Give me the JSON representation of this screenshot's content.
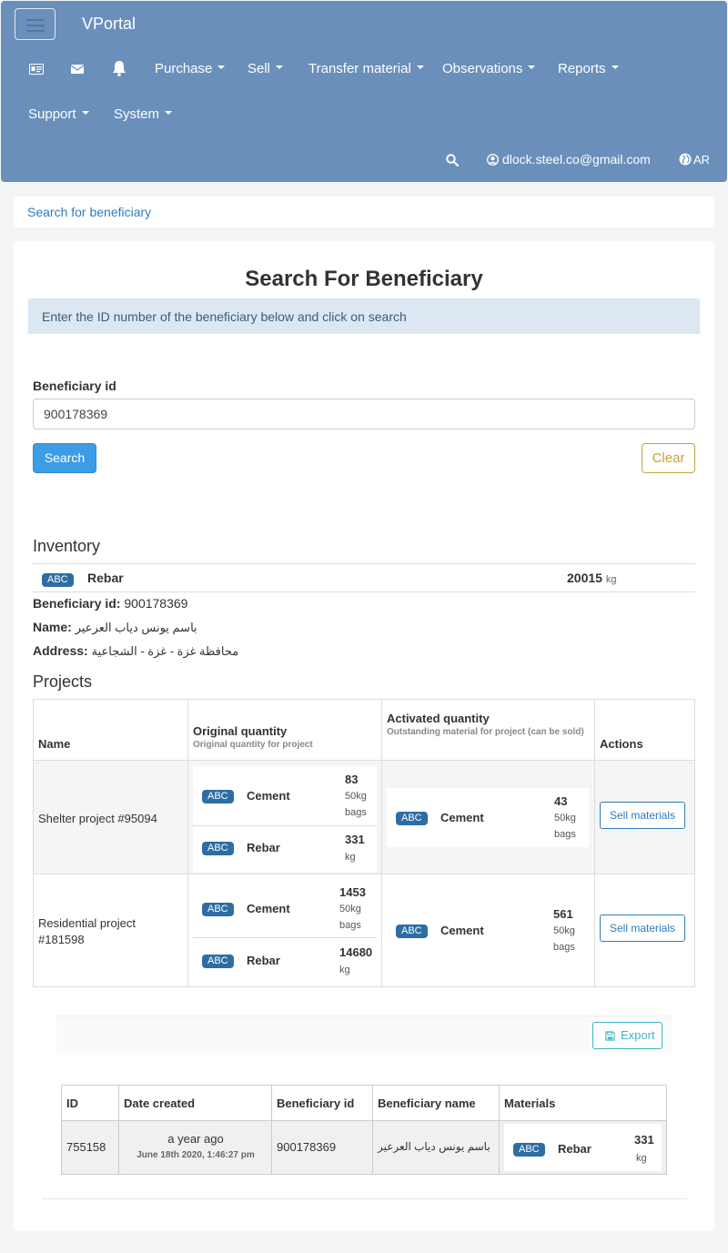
{
  "navbar": {
    "brand": "VPortal",
    "menus": [
      {
        "label": "Purchase"
      },
      {
        "label": "Sell"
      },
      {
        "label": "Transfer material"
      },
      {
        "label": "Observations"
      },
      {
        "label": "Reports"
      },
      {
        "label": "Support"
      },
      {
        "label": "System"
      }
    ],
    "user_email": "dlock.steel.co@gmail.com",
    "language": "AR",
    "icons": [
      "id-card-icon",
      "envelope-icon",
      "bell-icon",
      "search-icon",
      "user-circle-icon",
      "globe-icon"
    ],
    "background_color": "#6a8fbb"
  },
  "breadcrumb": {
    "label": "Search for beneficiary"
  },
  "search_form": {
    "title": "Search For Beneficiary",
    "info": "Enter the ID number of the beneficiary below and click on search",
    "field_label": "Beneficiary id",
    "field_value": "900178369",
    "search_button": "Search",
    "clear_button": "Clear"
  },
  "inventory": {
    "title": "Inventory",
    "items": [
      {
        "badge": "ABC",
        "material": "Rebar",
        "quantity": "20015",
        "unit": "kg"
      }
    ]
  },
  "beneficiary": {
    "id_label": "Beneficiary id:",
    "id_value": "900178369",
    "name_label": "Name:",
    "name_value": "باسم يونس دياب العرعير",
    "address_label": "Address:",
    "address_value": "محافظة غزة - غزة - الشجاعية"
  },
  "projects": {
    "title": "Projects",
    "headers": {
      "name": "Name",
      "original": "Original quantity",
      "original_sub": "Original quantity for project",
      "activated": "Activated quantity",
      "activated_sub": "Outstanding material for project (can be sold)",
      "actions": "Actions"
    },
    "rows": [
      {
        "name": "Shelter project #95094",
        "original": [
          {
            "badge": "ABC",
            "material": "Cement",
            "qty": "83",
            "unit1": "50kg",
            "unit2": "bags"
          },
          {
            "badge": "ABC",
            "material": "Rebar",
            "qty": "331",
            "unit1": "kg",
            "unit2": ""
          }
        ],
        "activated": [
          {
            "badge": "ABC",
            "material": "Cement",
            "qty": "43",
            "unit1": "50kg",
            "unit2": "bags"
          }
        ],
        "action": "Sell materials"
      },
      {
        "name": "Residential project #181598",
        "name_line1": "Residential project",
        "name_line2": "#181598",
        "original": [
          {
            "badge": "ABC",
            "material": "Cement",
            "qty": "1453",
            "unit1": "50kg",
            "unit2": "bags"
          },
          {
            "badge": "ABC",
            "material": "Rebar",
            "qty": "14680",
            "unit1": "kg",
            "unit2": ""
          }
        ],
        "activated": [
          {
            "badge": "ABC",
            "material": "Cement",
            "qty": "561",
            "unit1": "50kg",
            "unit2": "bags"
          }
        ],
        "action": "Sell materials"
      }
    ]
  },
  "export": {
    "label": "Export"
  },
  "orders": {
    "headers": [
      "ID",
      "Date created",
      "Beneficiary id",
      "Beneficiary name",
      "Materials"
    ],
    "rows": [
      {
        "id": "755158",
        "date_relative": "a year ago",
        "date_full": "June 18th 2020, 1:46:27 pm",
        "beneficiary_id": "900178369",
        "beneficiary_name": "باسم يونس دياب العرعير",
        "material_badge": "ABC",
        "material": "Rebar",
        "qty": "331",
        "unit": "kg"
      }
    ]
  }
}
